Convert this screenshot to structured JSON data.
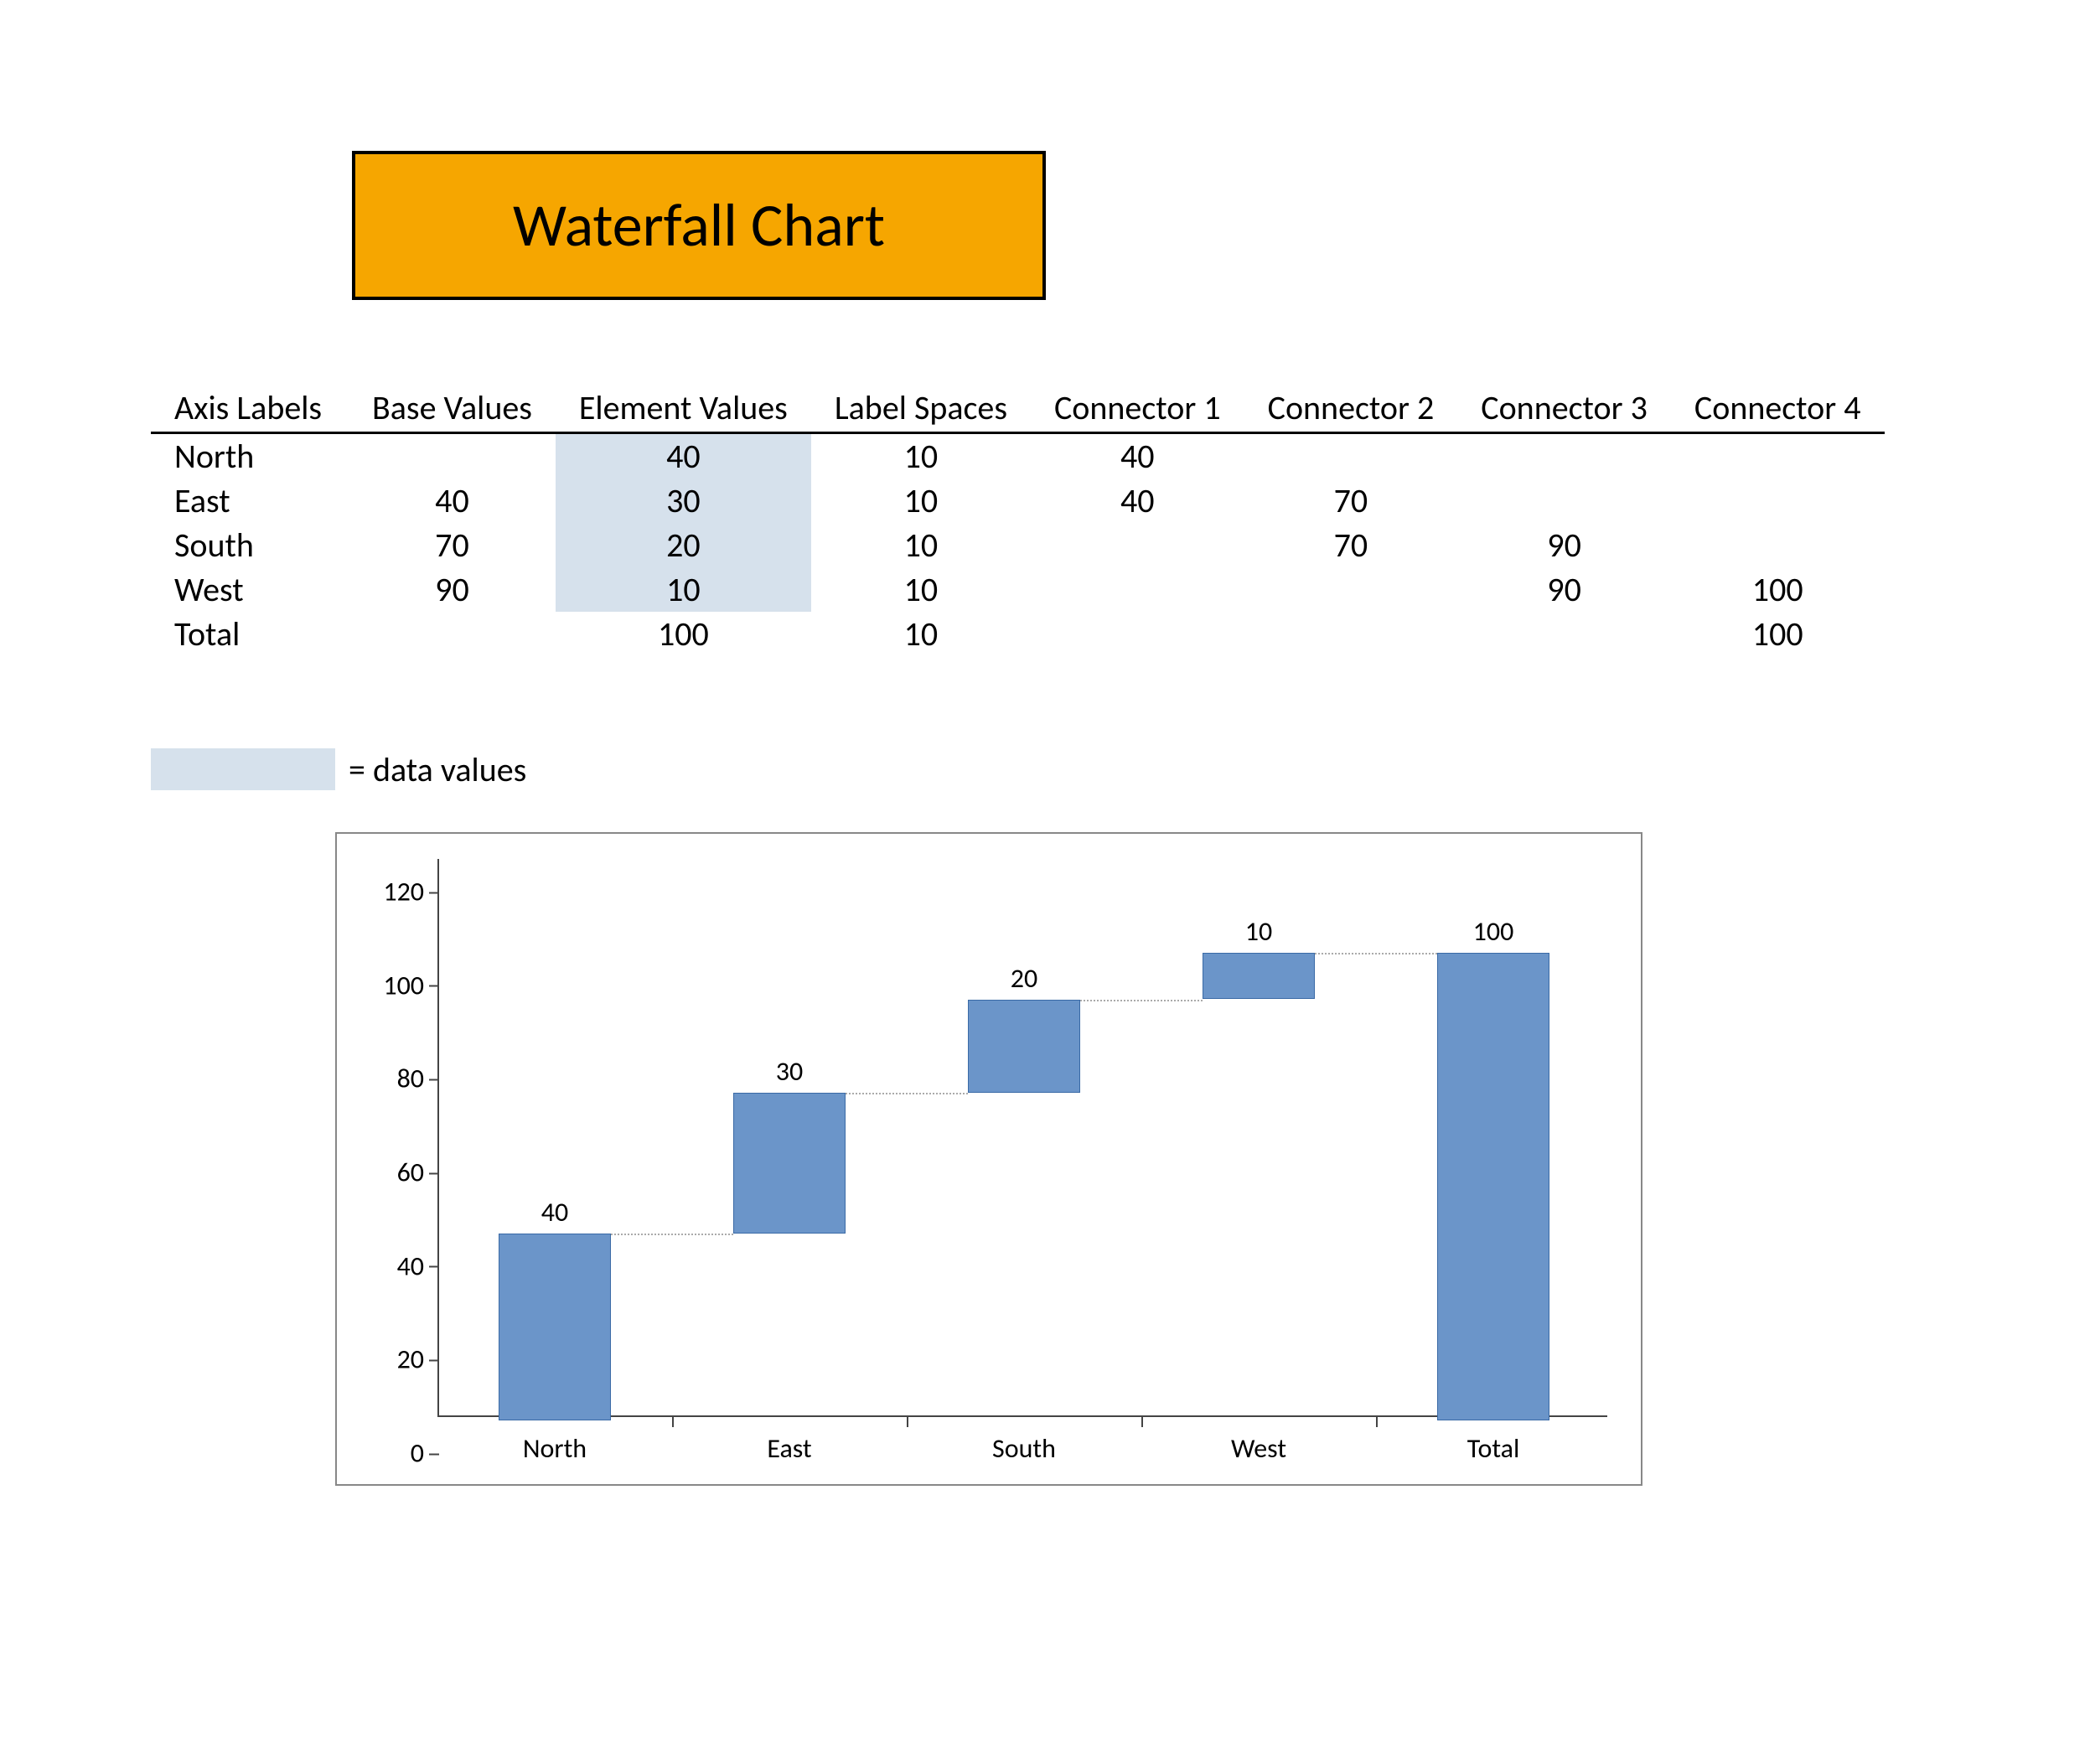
{
  "title": "Waterfall Chart",
  "table": {
    "headers": [
      "Axis Labels",
      "Base Values",
      "Element Values",
      "Label Spaces",
      "Connector 1",
      "Connector 2",
      "Connector 3",
      "Connector 4"
    ],
    "rows": [
      {
        "label": "North",
        "base": "",
        "element": "40",
        "space": "10",
        "c1": "40",
        "c2": "",
        "c3": "",
        "c4": ""
      },
      {
        "label": "East",
        "base": "40",
        "element": "30",
        "space": "10",
        "c1": "40",
        "c2": "70",
        "c3": "",
        "c4": ""
      },
      {
        "label": "South",
        "base": "70",
        "element": "20",
        "space": "10",
        "c1": "",
        "c2": "70",
        "c3": "90",
        "c4": ""
      },
      {
        "label": "West",
        "base": "90",
        "element": "10",
        "space": "10",
        "c1": "",
        "c2": "",
        "c3": "90",
        "c4": "100"
      },
      {
        "label": "Total",
        "base": "",
        "element": "100",
        "space": "10",
        "c1": "",
        "c2": "",
        "c3": "",
        "c4": "100"
      }
    ]
  },
  "legend_text": "= data values",
  "chart_data": {
    "type": "bar",
    "subtype": "waterfall",
    "categories": [
      "North",
      "East",
      "South",
      "West",
      "Total"
    ],
    "base": [
      0,
      40,
      70,
      90,
      0
    ],
    "values": [
      40,
      30,
      20,
      10,
      100
    ],
    "labels": [
      "40",
      "30",
      "20",
      "10",
      "100"
    ],
    "ylim": [
      0,
      120
    ],
    "yticks": [
      0,
      20,
      40,
      60,
      80,
      100,
      120
    ],
    "connectors": [
      {
        "from": 0,
        "to": 1,
        "y": 40
      },
      {
        "from": 1,
        "to": 2,
        "y": 70
      },
      {
        "from": 2,
        "to": 3,
        "y": 90
      },
      {
        "from": 3,
        "to": 4,
        "y": 100
      }
    ],
    "title": "",
    "xlabel": "",
    "ylabel": ""
  },
  "colors": {
    "bar": "#6b95c9",
    "bar_border": "#3a6aa6",
    "highlight": "#d6e1ec",
    "title_bg": "#f6a600"
  }
}
